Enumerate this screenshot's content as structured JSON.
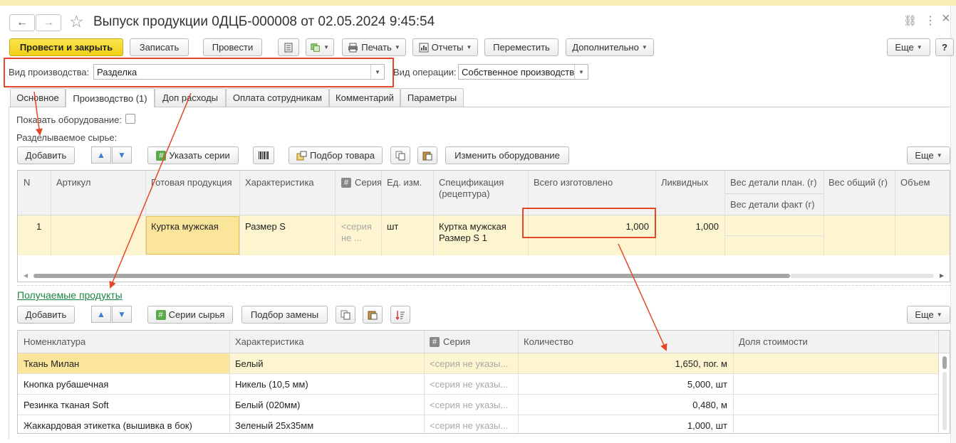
{
  "window": {
    "title": "Выпуск продукции 0ДЦБ-000008 от 02.05.2024 9:45:54",
    "back": "←",
    "forward": "→",
    "star": "☆",
    "link_icon": "⛓",
    "more_icon": "⋮",
    "close_icon": "×"
  },
  "toolbar": {
    "post_close": "Провести и закрыть",
    "save": "Записать",
    "post": "Провести",
    "print": "Печать",
    "reports": "Отчеты",
    "move": "Переместить",
    "additional": "Дополнительно",
    "more": "Еще",
    "help": "?"
  },
  "header": {
    "production_type_label": "Вид производства:",
    "production_type_value": "Разделка",
    "operation_type_label": "Вид операции:",
    "operation_type_value": "Собственное производстве"
  },
  "tabs": [
    {
      "label": "Основное"
    },
    {
      "label": "Производство (1)"
    },
    {
      "label": "Доп расходы"
    },
    {
      "label": "Оплата сотрудникам"
    },
    {
      "label": "Комментарий"
    },
    {
      "label": "Параметры"
    }
  ],
  "production": {
    "show_equipment_label": "Показать оборудование:",
    "raw_material_label": "Разделываемое сырье:",
    "buttons": {
      "add": "Добавить",
      "series": "Указать серии",
      "selection": "Подбор товара",
      "change_equipment": "Изменить оборудование",
      "more": "Еще"
    },
    "columns": {
      "n": "N",
      "article": "Артикул",
      "product": "Готовая продукция",
      "characteristic": "Характеристика",
      "series": "Серия",
      "unit": "Ед. изм.",
      "spec": "Спецификация (рецептура)",
      "total": "Всего изготовлено",
      "liquid": "Ликвидных",
      "weight_plan": "Вес детали план. (г)",
      "weight_fact": "Вес детали факт (г)",
      "weight_total": "Вес общий (г)",
      "volume": "Объем"
    },
    "rows": [
      {
        "n": "1",
        "article": "",
        "product": "Куртка мужская",
        "characteristic": "Размер S",
        "series": "<серия не ...",
        "unit": "шт",
        "spec": "Куртка мужская Размер S 1",
        "total": "1,000",
        "liquid": "1,000"
      }
    ]
  },
  "products": {
    "title": "Получаемые продукты",
    "buttons": {
      "add": "Добавить",
      "raw_series": "Серии сырья",
      "replace": "Подбор замены",
      "more": "Еще"
    },
    "columns": {
      "nomenclature": "Номенклатура",
      "characteristic": "Характеристика",
      "series": "Серия",
      "quantity": "Количество",
      "cost_share": "Доля стоимости"
    },
    "rows": [
      {
        "nomenclature": "Ткань Милан",
        "characteristic": "Белый",
        "series": "<серия не указы...",
        "quantity": "1,650, пог. м",
        "share": ""
      },
      {
        "nomenclature": "Кнопка рубашечная",
        "characteristic": "Никель (10,5 мм)",
        "series": "<серия не указы...",
        "quantity": "5,000, шт",
        "share": ""
      },
      {
        "nomenclature": "Резинка тканая Soft",
        "characteristic": "Белый (020мм)",
        "series": "<серия не указы...",
        "quantity": "0,480, м",
        "share": ""
      },
      {
        "nomenclature": "Жаккардовая этикетка (вышивка в бок)",
        "characteristic": "Зеленый 25х35мм",
        "series": "<серия не указы...",
        "quantity": "1,000, шт",
        "share": ""
      }
    ]
  },
  "colors": {
    "accent_yellow": "#f0cf17",
    "selected_row": "#fdf5cf",
    "active_cell": "#fbe59b",
    "annotation_red": "#e5462a",
    "link_green": "#1a8542"
  }
}
